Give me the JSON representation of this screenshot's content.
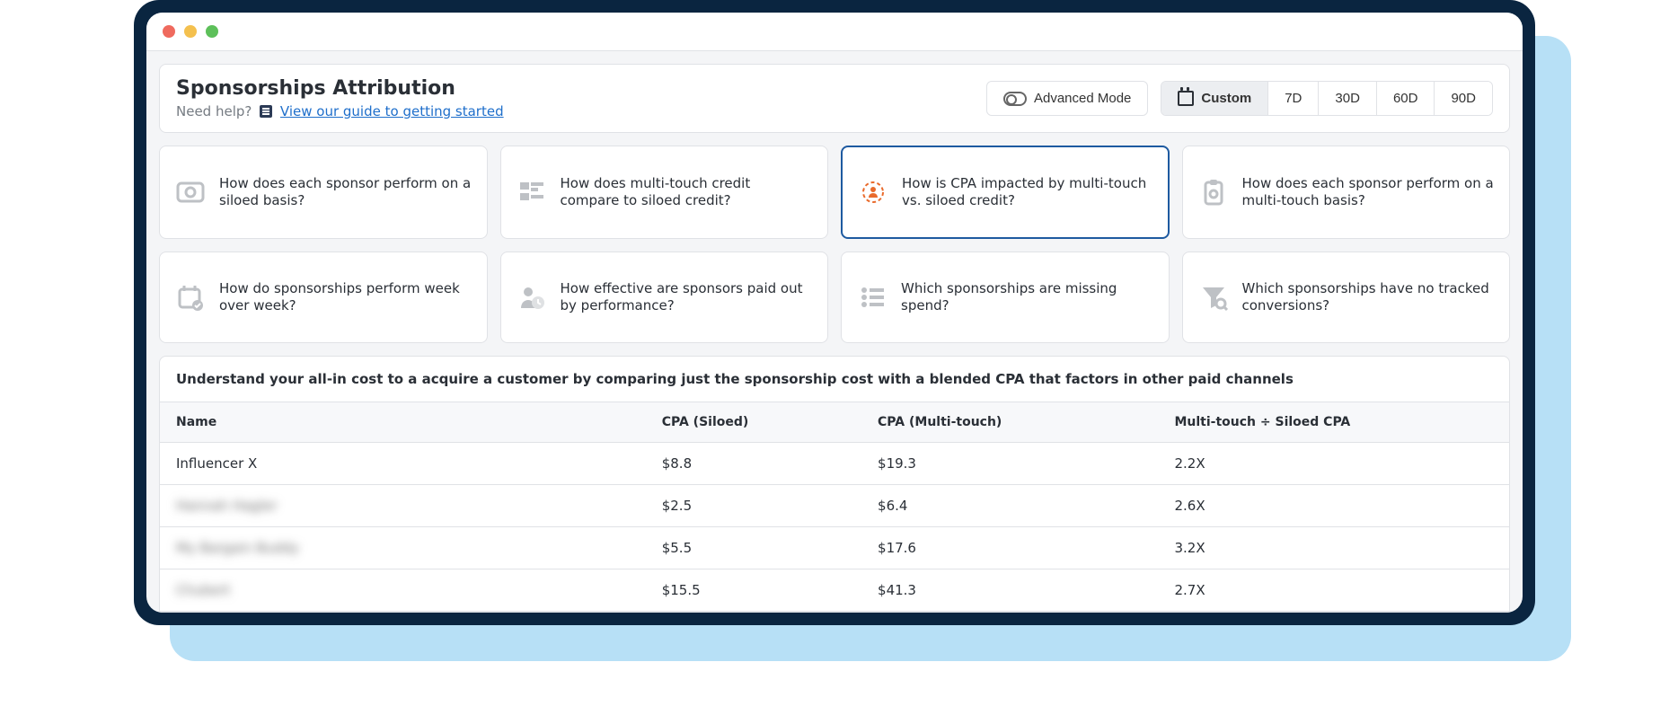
{
  "header": {
    "title": "Sponsorships Attribution",
    "help_prefix": "Need help?",
    "guide_link_text": "View our guide to getting started",
    "advanced_mode_label": "Advanced Mode",
    "range": {
      "custom": "Custom",
      "d7": "7D",
      "d30": "30D",
      "d60": "60D",
      "d90": "90D",
      "active": "custom"
    }
  },
  "questions": [
    {
      "id": "siloed-perf",
      "icon": "eye-icon",
      "text": "How does each sponsor perform on a siloed basis?"
    },
    {
      "id": "mt-vs-siloed-credit",
      "icon": "blocks-icon",
      "text": "How does multi-touch credit compare to siloed credit?"
    },
    {
      "id": "cpa-impact",
      "icon": "target-icon",
      "text": "How is CPA impacted by multi-touch vs. siloed credit?",
      "active": true
    },
    {
      "id": "mt-perf",
      "icon": "clipboard-icon",
      "text": "How does each sponsor perform on a multi-touch basis?"
    },
    {
      "id": "week-over-week",
      "icon": "calendar-check-icon",
      "text": "How do sponsorships perform week over week?"
    },
    {
      "id": "paid-perf",
      "icon": "person-clock-icon",
      "text": "How effective are sponsors paid out by performance?"
    },
    {
      "id": "missing-spend",
      "icon": "list-icon",
      "text": "Which sponsorships are missing spend?"
    },
    {
      "id": "no-conversions",
      "icon": "funnel-search-icon",
      "text": "Which sponsorships have no tracked conversions?"
    }
  ],
  "section": {
    "headline": "Understand your all-in cost to a acquire a customer by comparing just the sponsorship cost with a blended CPA that factors in other paid channels"
  },
  "table": {
    "columns": [
      "Name",
      "CPA (Siloed)",
      "CPA (Multi-touch)",
      "Multi-touch ÷ Siloed CPA"
    ],
    "rows": [
      {
        "name": "Influencer X",
        "cpa_siloed": "$8.8",
        "cpa_mt": "$19.3",
        "ratio": "2.2X",
        "blurred": false
      },
      {
        "name": "Hannah Hagler",
        "cpa_siloed": "$2.5",
        "cpa_mt": "$6.4",
        "ratio": "2.6X",
        "blurred": true
      },
      {
        "name": "My Bargain Buddy",
        "cpa_siloed": "$5.5",
        "cpa_mt": "$17.6",
        "ratio": "3.2X",
        "blurred": true
      },
      {
        "name": "Chubert",
        "cpa_siloed": "$15.5",
        "cpa_mt": "$41.3",
        "ratio": "2.7X",
        "blurred": true
      }
    ]
  }
}
